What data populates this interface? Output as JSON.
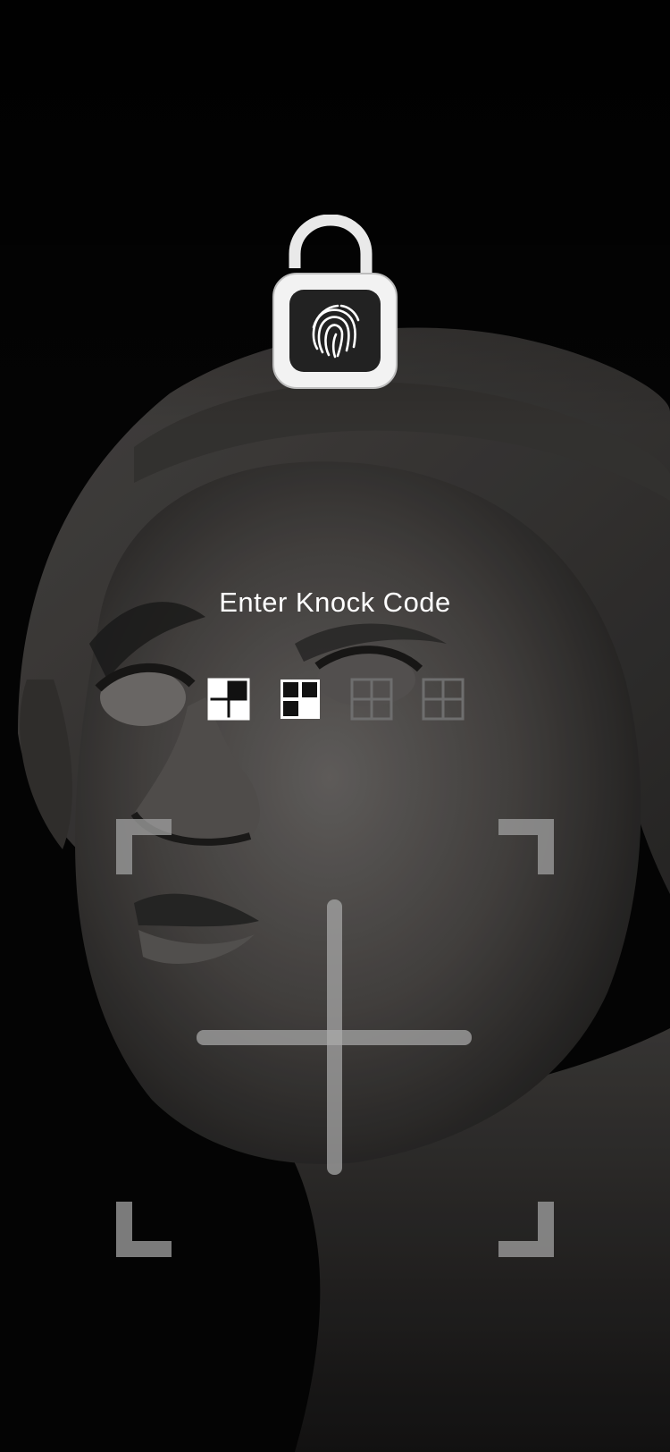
{
  "lock_screen": {
    "prompt_text": "Enter Knock Code",
    "lock_icon": "unlocked-padlock-fingerprint-icon",
    "knock_code": {
      "entered_count": 2,
      "total_count": 4,
      "indicators": [
        {
          "state": "entered",
          "tapped_quadrant": "top-right"
        },
        {
          "state": "entered",
          "tapped_quadrant": "bottom-right"
        },
        {
          "state": "empty",
          "tapped_quadrant": ""
        },
        {
          "state": "empty",
          "tapped_quadrant": ""
        }
      ]
    },
    "pad": {
      "quadrants": [
        "top-left",
        "top-right",
        "bottom-left",
        "bottom-right"
      ]
    }
  },
  "colors": {
    "background": "#050505",
    "text": "#ffffff",
    "indicator_active": "#ffffff",
    "indicator_inactive": "#6e6e6e",
    "pad_guides": "#9a9a9a"
  }
}
